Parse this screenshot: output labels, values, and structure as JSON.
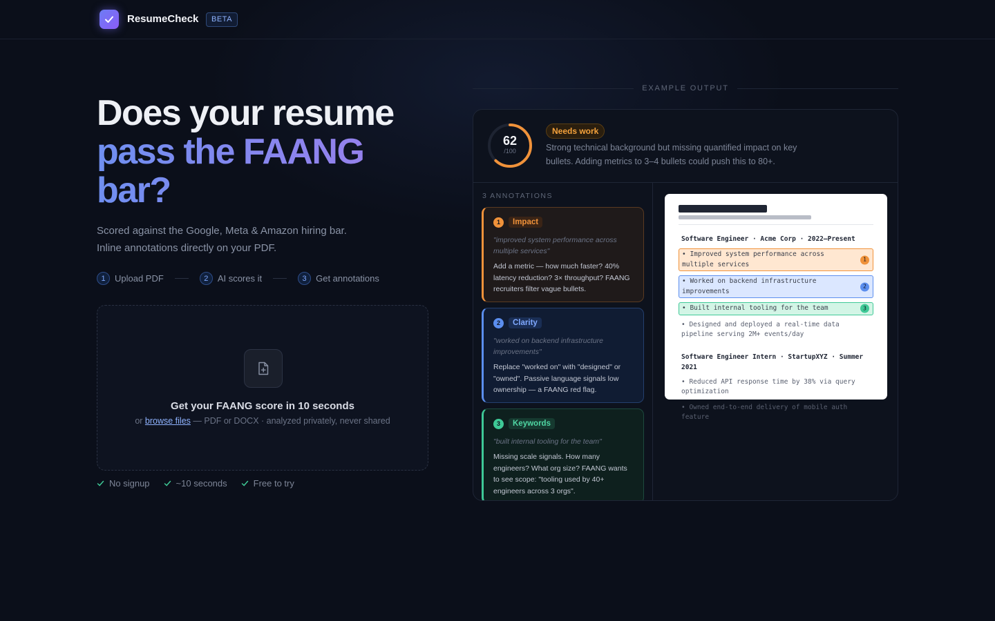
{
  "header": {
    "brand": "ResumeCheck",
    "badge": "BETA"
  },
  "hero": {
    "title_line1": "Does your resume",
    "title_line2": "pass the FAANG",
    "title_line3": "bar?",
    "subtitle_line1": "Scored against the Google, Meta & Amazon hiring bar.",
    "subtitle_line2": "Inline annotations directly on your PDF."
  },
  "steps": [
    {
      "num": "1",
      "label": "Upload PDF"
    },
    {
      "num": "2",
      "label": "AI scores it"
    },
    {
      "num": "3",
      "label": "Get annotations"
    }
  ],
  "dropzone": {
    "title": "Get your FAANG score in 10 seconds",
    "prefix": "or ",
    "link": "browse files",
    "suffix": " — PDF or DOCX · analyzed privately, never shared"
  },
  "checks": [
    "No signup",
    "~10 seconds",
    "Free to try"
  ],
  "example": {
    "label": "EXAMPLE OUTPUT",
    "score": "62",
    "score_max": "/100",
    "score_fraction": 0.62,
    "status": "Needs work",
    "summary": "Strong technical background but missing quantified impact on key bullets. Adding metrics to 3–4 bullets could push this to 80+.",
    "annotations_count": "3 ANNOTATIONS",
    "annotations": [
      {
        "num": "1",
        "tag": "Impact",
        "quote": "\"improved system performance across multiple services\"",
        "body": "Add a metric — how much faster? 40% latency reduction? 3× throughput? FAANG recruiters filter vague bullets."
      },
      {
        "num": "2",
        "tag": "Clarity",
        "quote": "\"worked on backend infrastructure improvements\"",
        "body": "Replace \"worked on\" with \"designed\" or \"owned\". Passive language signals low ownership — a FAANG red flag."
      },
      {
        "num": "3",
        "tag": "Keywords",
        "quote": "\"built internal tooling for the team\"",
        "body": "Missing scale signals. How many engineers? What org size? FAANG wants to see scope: \"tooling used by 40+ engineers across 3 orgs\"."
      }
    ],
    "resume": {
      "job1": "Software Engineer · Acme Corp · 2022–Present",
      "job1_bullets": [
        {
          "text": "• Improved system performance across multiple services",
          "mark": "1"
        },
        {
          "text": "• Worked on backend infrastructure improvements",
          "mark": "2"
        },
        {
          "text": "• Built internal tooling for the team",
          "mark": "3"
        },
        {
          "text": "• Designed and deployed a real-time data pipeline serving 2M+ events/day",
          "mark": ""
        }
      ],
      "job2": "Software Engineer Intern · StartupXYZ · Summer 2021",
      "job2_bullets": [
        "• Reduced API response time by 38% via query optimization",
        "• Owned end-to-end delivery of mobile auth feature"
      ]
    }
  },
  "colors": {
    "accent": "#6d7cf5",
    "impact": "#f0923a",
    "clarity": "#5b8eee",
    "keywords": "#3ec996"
  }
}
